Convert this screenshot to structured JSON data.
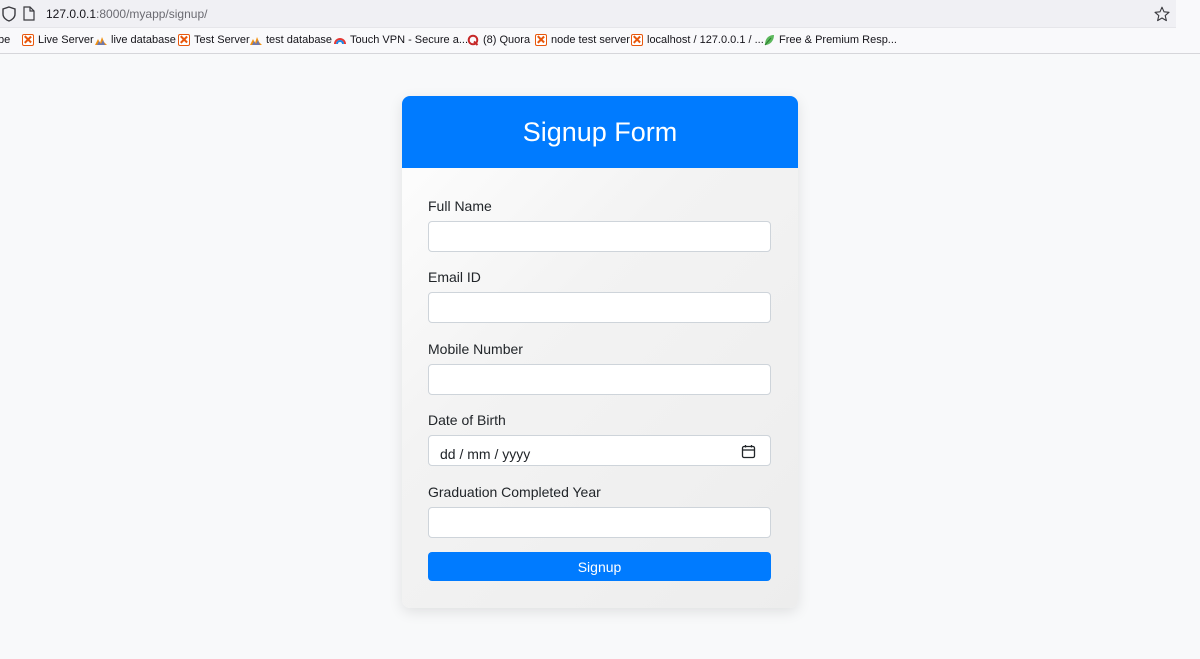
{
  "browser": {
    "url_host": "127.0.0.1",
    "url_rest": ":8000/myapp/signup/",
    "bookmarks": [
      {
        "label": "be",
        "icon": "truncated"
      },
      {
        "label": "Live Server",
        "icon": "xampp-icon"
      },
      {
        "label": "live database",
        "icon": "phpmyadmin-icon"
      },
      {
        "label": "Test Server",
        "icon": "xampp-icon"
      },
      {
        "label": "test database",
        "icon": "phpmyadmin-icon"
      },
      {
        "label": "Touch VPN - Secure a...",
        "icon": "vpn-rainbow-icon"
      },
      {
        "label": "(8) Quora",
        "icon": "quora-icon"
      },
      {
        "label": "node test server",
        "icon": "xampp-icon"
      },
      {
        "label": "localhost / 127.0.0.1 / ...",
        "icon": "xampp-icon"
      },
      {
        "label": "Free & Premium Resp...",
        "icon": "leaf-icon"
      }
    ]
  },
  "form": {
    "title": "Signup Form",
    "fields": [
      {
        "label": "Full Name",
        "value": ""
      },
      {
        "label": "Email ID",
        "value": ""
      },
      {
        "label": "Mobile Number",
        "value": ""
      },
      {
        "label": "Date of Birth",
        "placeholder": "dd / mm / yyyy"
      },
      {
        "label": "Graduation Completed Year",
        "value": ""
      }
    ],
    "submit_label": "Signup"
  },
  "colors": {
    "primary": "#007bff",
    "page_background": "#f8f9fa"
  }
}
